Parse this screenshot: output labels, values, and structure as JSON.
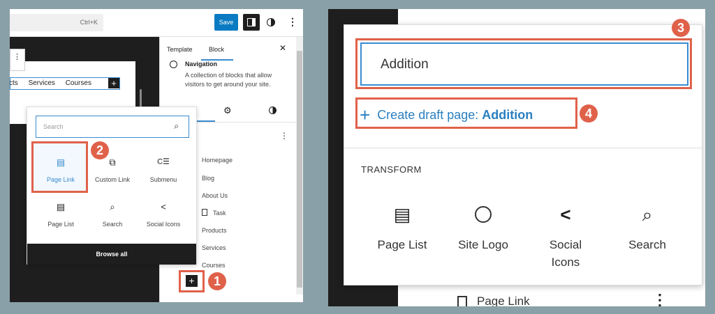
{
  "left": {
    "toolbar": {
      "shortcut": "Ctrl+K",
      "save_label": "Save"
    },
    "canvas": {
      "nav_items": [
        "cts",
        "Services",
        "Courses"
      ]
    },
    "sidebar": {
      "tabs": [
        "Template",
        "Block"
      ],
      "block_title": "Navigation",
      "block_desc_1": "A collection of blocks that allow",
      "block_desc_2": "visitors to get around your site.",
      "menu_items": [
        "Homepage",
        "Blog",
        "About Us",
        "Task",
        "Products",
        "Services",
        "Courses"
      ]
    },
    "inserter": {
      "search_placeholder": "Search",
      "items": [
        "Page Link",
        "Custom Link",
        "Submenu",
        "Page List",
        "Search",
        "Social Icons"
      ],
      "browse_all": "Browse all"
    },
    "badges": [
      "1",
      "2"
    ]
  },
  "right": {
    "input_value": "Addition",
    "create_prefix": "Create draft page: ",
    "create_name": "Addition",
    "transform_label": "TRANSFORM",
    "transforms": [
      [
        "Page List"
      ],
      [
        "Site Logo"
      ],
      [
        "Social",
        "Icons"
      ],
      [
        "Search"
      ]
    ],
    "below_item": "Page Link",
    "badges": [
      "3",
      "4"
    ]
  }
}
